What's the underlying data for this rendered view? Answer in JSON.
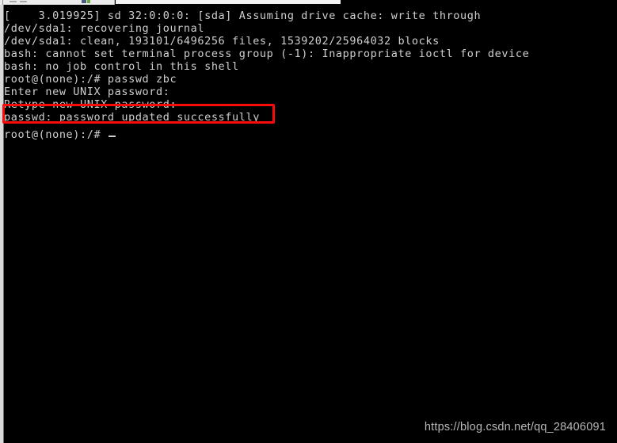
{
  "window": {
    "chrome_fragment_visible": true,
    "background_color": "#000000",
    "text_color": "#cfcfcf",
    "highlight_color": "#fb0a0a"
  },
  "terminal": {
    "prompt": "root@(none):/#",
    "cursor": "_",
    "lines": [
      {
        "id": "boot-sd-cache",
        "text": "[    3.019925] sd 32:0:0:0: [sda] Assuming drive cache: write through"
      },
      {
        "id": "fsck-recovering",
        "text": "/dev/sda1: recovering journal"
      },
      {
        "id": "fsck-clean",
        "text": "/dev/sda1: clean, 193101/6496256 files, 1539202/25964032 blocks"
      },
      {
        "id": "bash-ioctl-error",
        "text": "bash: cannot set terminal process group (-1): Inappropriate ioctl for device"
      },
      {
        "id": "bash-no-job-ctrl",
        "text": "bash: no job control in this shell"
      },
      {
        "id": "cmd-passwd",
        "text": "root@(none):/# passwd zbc"
      },
      {
        "id": "prompt-enter-pw",
        "text": "Enter new UNIX password:"
      },
      {
        "id": "prompt-retype-pw",
        "text": "Retype new UNIX password:"
      },
      {
        "id": "result-success",
        "text": "passwd: password updated successfully"
      },
      {
        "id": "final-prompt",
        "text": "root@(none):/#"
      }
    ]
  },
  "annotation": {
    "target_line_id": "result-success",
    "shape": "rectangle",
    "color": "#fb0a0a"
  },
  "watermark": {
    "text": "https://blog.csdn.net/qq_28406091"
  }
}
